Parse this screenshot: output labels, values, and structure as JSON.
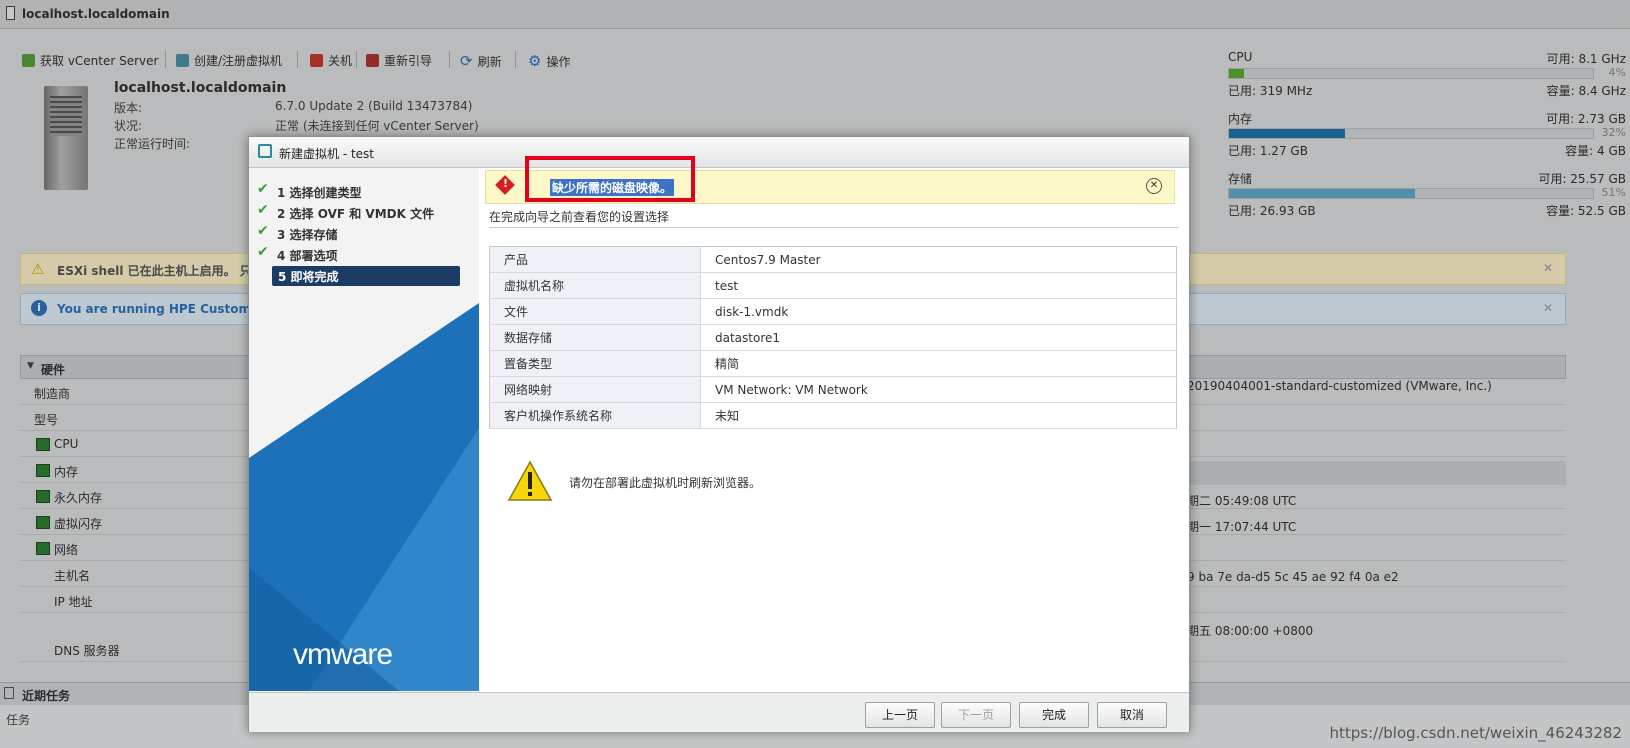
{
  "window": {
    "title": "localhost.localdomain"
  },
  "toolbar": {
    "vcenter": "获取 vCenter Server",
    "create_vm": "创建/注册虚拟机",
    "shutdown": "关机",
    "reboot": "重新引导",
    "refresh": "刷新",
    "actions": "操作"
  },
  "host": {
    "name": "localhost.localdomain",
    "version_label": "版本:",
    "version_value": "6.7.0 Update 2 (Build 13473784)",
    "state_label": "状况:",
    "state_value": "正常 (未连接到任何 vCenter Server)",
    "uptime_label": "正常运行时间:"
  },
  "resources": {
    "cpu": {
      "title": "CPU",
      "free": "可用: 8.1 GHz",
      "pct": "4%",
      "used": "已用: 319 MHz",
      "capacity": "容量: 8.4 GHz",
      "fill": 0.04
    },
    "memory": {
      "title": "内存",
      "free": "可用: 2.73 GB",
      "pct": "32%",
      "used": "已用: 1.27 GB",
      "capacity": "容量: 4 GB",
      "fill": 0.32
    },
    "storage": {
      "title": "存储",
      "free": "可用: 25.57 GB",
      "pct": "51%",
      "used": "已用: 26.93 GB",
      "capacity": "容量: 52.5 GB",
      "fill": 0.51
    }
  },
  "banners": {
    "ssh": "ESXi shell 已在此主机上启用。 只有",
    "hpe": "You are running HPE Customized"
  },
  "hardware": {
    "header": "硬件",
    "rows": [
      "制造商",
      "型号",
      "CPU",
      "内存",
      "永久内存",
      "虚拟闪存",
      "网络",
      "主机名",
      "IP 地址",
      "DNS 服务器"
    ],
    "right_values": [
      "20190404001-standard-customized (VMware, Inc.)",
      "期二 05:49:08 UTC",
      "期一 17:07:44 UTC",
      "9 ba 7e da-d5 5c 45 ae 92 f4 0a e2",
      "期五 08:00:00 +0800"
    ]
  },
  "tasks": {
    "title": "近期任务",
    "col_task": "任务"
  },
  "dialog": {
    "title": "新建虚拟机 - test",
    "steps": [
      "1 选择创建类型",
      "2 选择 OVF 和 VMDK 文件",
      "3 选择存储",
      "4 部署选项",
      "5 即将完成"
    ],
    "error": "缺少所需的磁盘映像。",
    "subtitle": "在完成向导之前查看您的设置选择",
    "summary": [
      {
        "key": "产品",
        "value": "Centos7.9 Master"
      },
      {
        "key": "虚拟机名称",
        "value": "test"
      },
      {
        "key": "文件",
        "value": "disk-1.vmdk"
      },
      {
        "key": "数据存储",
        "value": "datastore1"
      },
      {
        "key": "置备类型",
        "value": "精简"
      },
      {
        "key": "网络映射",
        "value": "VM Network: VM Network"
      },
      {
        "key": "客户机操作系统名称",
        "value": "未知"
      }
    ],
    "warning": "请勿在部署此虚拟机时刷新浏览器。",
    "brand": "vmware",
    "buttons": {
      "back": "上一页",
      "next": "下一页",
      "finish": "完成",
      "cancel": "取消"
    }
  },
  "watermark": "https://blog.csdn.net/weixin_46243282",
  "colors": {
    "accent": "#1c3d63",
    "error_box": "#e2001a",
    "vmware_blue": "#1d71b8"
  }
}
